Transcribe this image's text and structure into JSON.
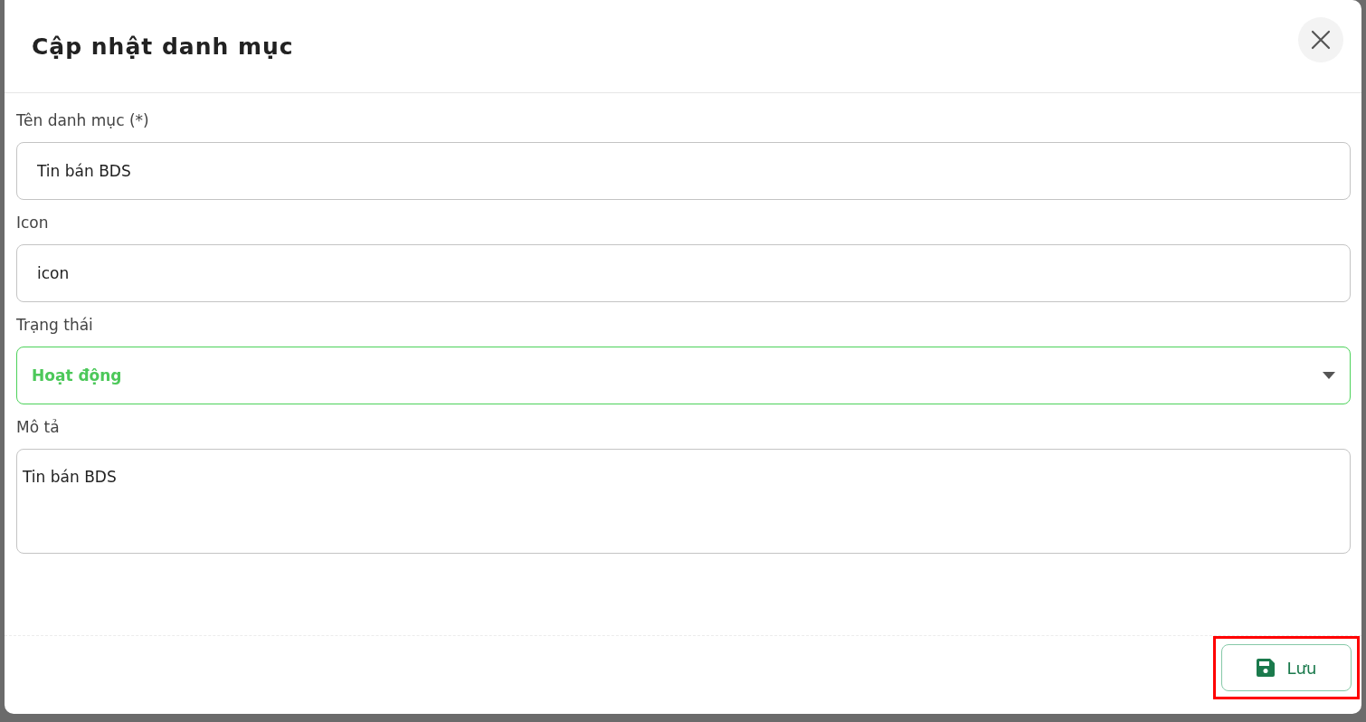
{
  "dialog": {
    "title": "Cập nhật danh mục"
  },
  "fields": [
    {
      "kind": "text",
      "label": "Tên danh mục (*)",
      "value": "Tin bán BDS"
    },
    {
      "kind": "text",
      "label": "Icon",
      "value": "icon"
    },
    {
      "kind": "select",
      "label": "Trạng thái",
      "value": "Hoạt động"
    },
    {
      "kind": "textarea",
      "label": "Mô tả",
      "value": "Tin bán BDS"
    }
  ],
  "save_button": {
    "label": "Lưu",
    "highlighted": true
  }
}
